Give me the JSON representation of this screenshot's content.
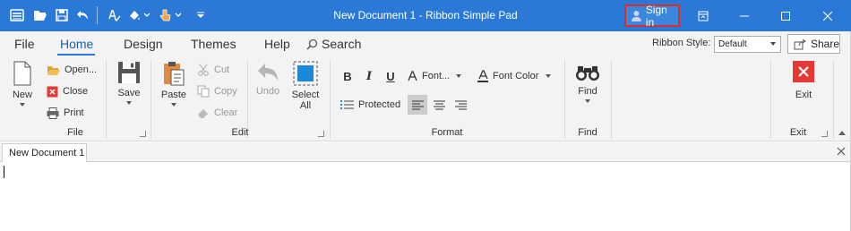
{
  "window": {
    "title": "New Document 1 - Ribbon Simple Pad",
    "sign_in_label": "Sign in",
    "accent_color": "#2b79d7"
  },
  "quick_access": {
    "icons": [
      "app-menu-icon",
      "open-folder-icon",
      "save-icon",
      "undo-icon",
      "spell-check-icon",
      "paint-icon",
      "touch-mode-icon",
      "customize-icon"
    ]
  },
  "tabs": [
    {
      "label": "File"
    },
    {
      "label": "Home"
    },
    {
      "label": "Design"
    },
    {
      "label": "Themes"
    },
    {
      "label": "Help"
    }
  ],
  "search_label": "Search",
  "ribbon_style": {
    "label": "Ribbon Style:",
    "value": "Default"
  },
  "share_label": "Share",
  "groups": {
    "file": {
      "label": "File",
      "new_label": "New",
      "open_label": "Open...",
      "close_label": "Close",
      "print_label": "Print",
      "save_label": "Save"
    },
    "edit": {
      "label": "Edit",
      "paste_label": "Paste",
      "cut_label": "Cut",
      "copy_label": "Copy",
      "clear_label": "Clear",
      "undo_label": "Undo",
      "select_all_line1": "Select",
      "select_all_line2": "All"
    },
    "format": {
      "label": "Format",
      "bold": "B",
      "italic": "I",
      "underline": "U",
      "font_label": "Font...",
      "font_color_label": "Font Color",
      "protected_label": "Protected"
    },
    "find": {
      "label": "Find",
      "find_label": "Find"
    },
    "exit": {
      "label": "Exit",
      "exit_label": "Exit"
    }
  },
  "document": {
    "tab_label": "New Document 1"
  }
}
